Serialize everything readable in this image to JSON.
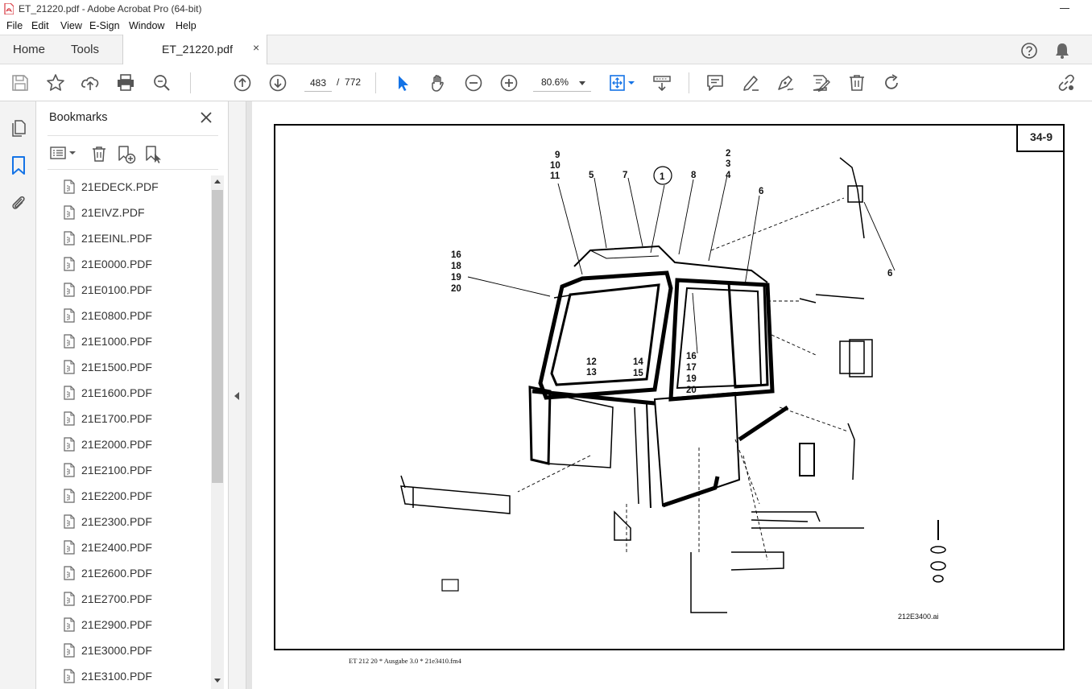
{
  "window": {
    "title": "ET_21220.pdf - Adobe Acrobat Pro (64-bit)"
  },
  "menu": [
    "File",
    "Edit",
    "View",
    "E-Sign",
    "Window",
    "Help"
  ],
  "tabs": {
    "home": "Home",
    "tools": "Tools",
    "document": "ET_21220.pdf",
    "close_glyph": "×"
  },
  "toolbar": {
    "page_current": "483",
    "page_separator": "/",
    "page_total": "772",
    "zoom": "80.6%"
  },
  "bookmarks": {
    "title": "Bookmarks",
    "items": [
      "21EDECK.PDF",
      "21EIVZ.PDF",
      "21EEINL.PDF",
      "21E0000.PDF",
      "21E0100.PDF",
      "21E0800.PDF",
      "21E1000.PDF",
      "21E1500.PDF",
      "21E1600.PDF",
      "21E1700.PDF",
      "21E2000.PDF",
      "21E2100.PDF",
      "21E2200.PDF",
      "21E2300.PDF",
      "21E2400.PDF",
      "21E2600.PDF",
      "21E2700.PDF",
      "21E2900.PDF",
      "21E3000.PDF",
      "21E3100.PDF"
    ]
  },
  "document": {
    "page_label": "34-9",
    "figure_file": "212E3400.ai",
    "footer": "ET 212 20 * Ausgabe 3.0 * 21e3410.fm4",
    "callouts": [
      "9",
      "10",
      "11",
      "5",
      "7",
      "1",
      "8",
      "2",
      "3",
      "4",
      "6",
      "16",
      "18",
      "19",
      "20",
      "12",
      "13",
      "14",
      "15",
      "16",
      "17",
      "19",
      "20",
      "6"
    ]
  },
  "colors": {
    "accent": "#1473e6",
    "tab_bg": "#f3f3f3",
    "doc_bg": "#e4e4e4",
    "pdf_icon": "#d7373f"
  }
}
